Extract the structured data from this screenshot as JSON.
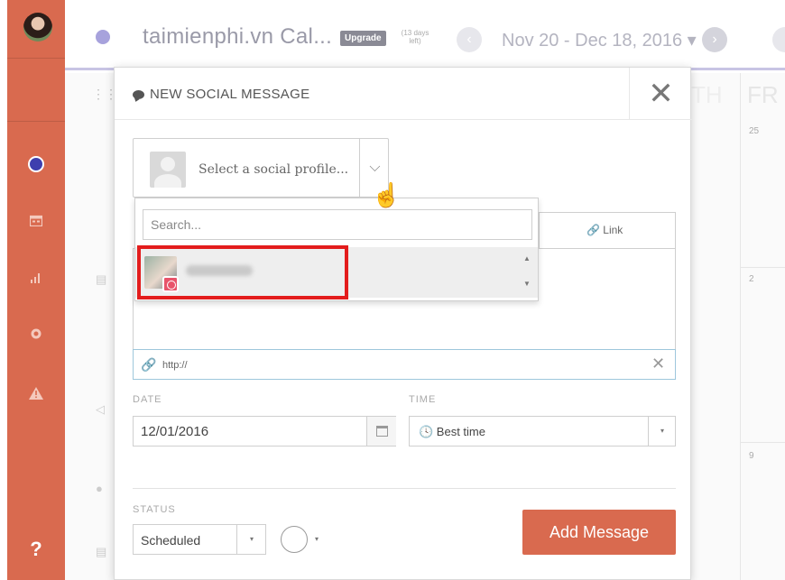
{
  "topbar": {
    "calendar_title": "taimienphi.vn Cal...",
    "upgrade_label": "Upgrade",
    "days_left": "(13 days left)",
    "date_range": "Nov 20 - Dec 18, 2016 ▾",
    "prev_glyph": "‹",
    "next_glyph": "›"
  },
  "calendar": {
    "day_header": "FR",
    "day_header_prev": "TH",
    "day_numbers": [
      "25",
      "2",
      "9"
    ]
  },
  "sidebar": {
    "help_label": "?",
    "icons": [
      "calendar-icon",
      "stats-icon",
      "settings-icon",
      "alert-icon"
    ],
    "accent": "#d96a4f"
  },
  "modal": {
    "title": "NEW SOCIAL MESSAGE",
    "close_glyph": "✕",
    "profile_select": {
      "placeholder": "Select a social profile...",
      "caret": "⌵"
    },
    "dropdown": {
      "search_placeholder": "Search...",
      "scroll_up": "▲",
      "scroll_down": "▼"
    },
    "link_tab": "🔗 Link",
    "url": {
      "value": "http://",
      "clear": "✕",
      "icon": "🔗"
    },
    "date": {
      "label": "DATE",
      "value": "12/01/2016"
    },
    "time": {
      "label": "TIME",
      "value": "🕓 Best time",
      "caret": "▾"
    },
    "status": {
      "label": "STATUS",
      "value": "Scheduled",
      "caret": "▾"
    },
    "color_caret": "▾",
    "add_button": "Add Message"
  },
  "colors": {
    "brand_orange": "#d96a4f",
    "highlight_red": "#e31c1c",
    "calendar_dot": "#a7a2dc"
  }
}
